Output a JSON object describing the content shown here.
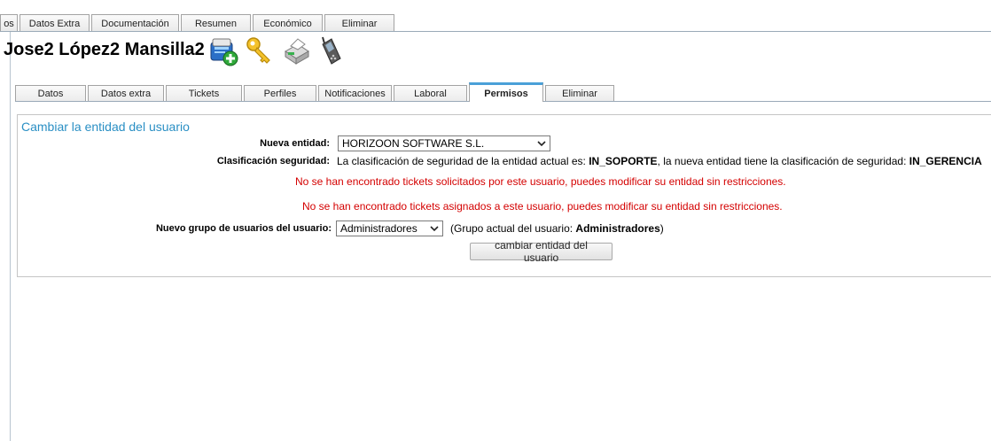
{
  "top_tabs": [
    {
      "label": "os",
      "w": 20
    },
    {
      "label": "Datos Extra",
      "w": 79
    },
    {
      "label": "Documentación",
      "w": 99
    },
    {
      "label": "Resumen",
      "w": 79
    },
    {
      "label": "Económico",
      "w": 79
    },
    {
      "label": "Eliminar",
      "w": 79
    }
  ],
  "title": "Jose2 López2 Mansilla2",
  "title_icons": [
    "add-card-icon",
    "key-icon",
    "printer-icon",
    "mobile-phone-icon"
  ],
  "inner_tabs": [
    {
      "label": "Datos",
      "active": false
    },
    {
      "label": "Datos extra",
      "active": false
    },
    {
      "label": "Tickets",
      "active": false
    },
    {
      "label": "Perfiles",
      "active": false
    },
    {
      "label": "Notificaciones",
      "active": false
    },
    {
      "label": "Laboral",
      "active": false
    },
    {
      "label": "Permisos",
      "active": true
    },
    {
      "label": "Eliminar",
      "active": false
    }
  ],
  "panel": {
    "title": "Cambiar la entidad del usuario",
    "nueva_entidad_label": "Nueva entidad:",
    "nueva_entidad_value": "HORIZOON SOFTWARE S.L.",
    "clasificacion_label": "Clasificación seguridad:",
    "clasificacion_text_1": "La clasificación de seguridad de la entidad actual es: ",
    "clasificacion_actual": "IN_SOPORTE",
    "clasificacion_text_2": ", la nueva entidad tiene la clasificación de seguridad: ",
    "clasificacion_nueva": "IN_GERENCIA",
    "msg_solicitados": "No se han encontrado tickets solicitados por este usuario, puedes modificar su entidad sin restricciones.",
    "msg_asignados": "No se han encontrado tickets asignados a este usuario, puedes modificar su entidad sin restricciones.",
    "grupo_label": "Nuevo grupo de usuarios del usuario:",
    "grupo_value": "Administradores",
    "grupo_actual_prefix": "(Grupo actual del usuario: ",
    "grupo_actual_value": "Administradores",
    "grupo_actual_suffix": ")",
    "submit_label": "cambiar entidad del usuario"
  },
  "colors": {
    "accent": "#2a8fc4",
    "active_tab_top": "#4aa0d8",
    "error": "#d40000"
  }
}
